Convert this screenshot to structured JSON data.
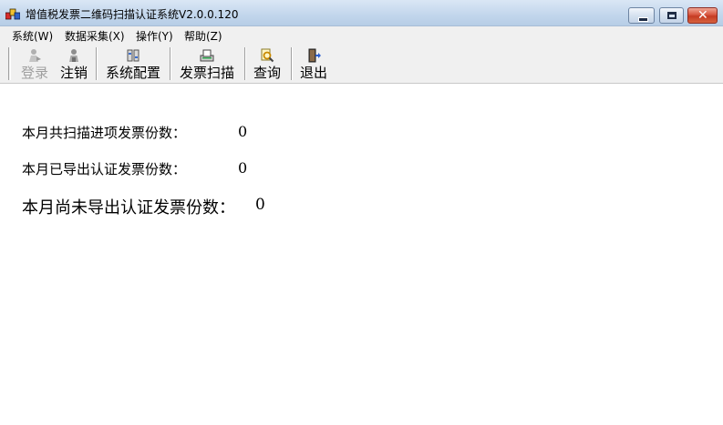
{
  "window": {
    "title": "增值税发票二维码扫描认证系统V2.0.0.120",
    "controls": {
      "close_glyph": "✕"
    }
  },
  "menu": {
    "items": [
      {
        "label": "系统(W)"
      },
      {
        "label": "数据采集(X)"
      },
      {
        "label": "操作(Y)"
      },
      {
        "label": "帮助(Z)"
      }
    ]
  },
  "toolbar": {
    "buttons": [
      {
        "label": "登录",
        "icon": "login-icon",
        "enabled": false
      },
      {
        "label": "注销",
        "icon": "logout-user-icon",
        "enabled": true
      },
      {
        "label": "系统配置",
        "icon": "config-icon",
        "enabled": true
      },
      {
        "label": "发票扫描",
        "icon": "scanner-icon",
        "enabled": true
      },
      {
        "label": "查询",
        "icon": "search-icon",
        "enabled": true
      },
      {
        "label": "退出",
        "icon": "exit-door-icon",
        "enabled": true
      }
    ]
  },
  "stats": {
    "scanned_label": "本月共扫描进项发票份数：",
    "scanned_value": "0",
    "exported_label": "本月已导出认证发票份数：",
    "exported_value": "0",
    "pending_label": "本月尚未导出认证发票份数：",
    "pending_value": "0"
  },
  "colors": {
    "titlebar": "#c2d6ec",
    "close_button": "#c53b22",
    "toolbar_bg": "#f0f0f0",
    "disabled_text": "#a0a0a0"
  }
}
